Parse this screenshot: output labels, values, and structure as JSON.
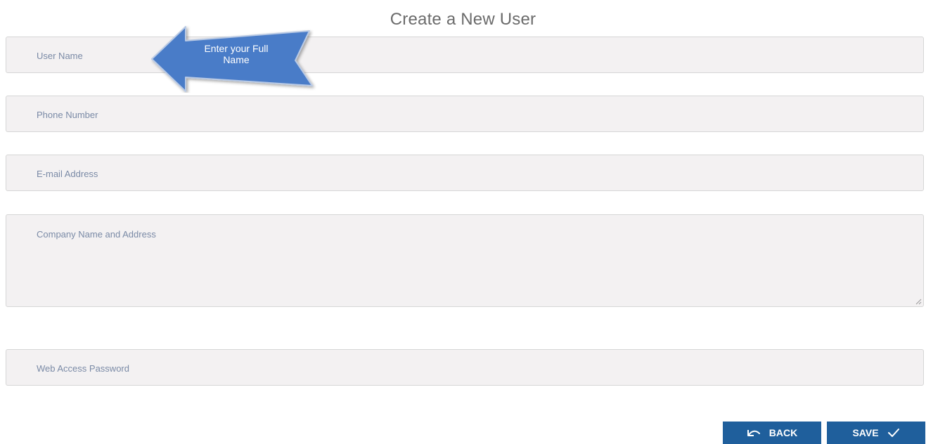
{
  "page": {
    "title": "Create a New User"
  },
  "form": {
    "user_name_placeholder": "User Name",
    "phone_placeholder": "Phone Number",
    "email_placeholder": "E-mail Address",
    "company_placeholder": "Company Name and Address",
    "password_placeholder": "Web Access Password"
  },
  "callout": {
    "text": "Enter your Full Name",
    "color": "#4a7bc8"
  },
  "buttons": {
    "back_label": "BACK",
    "back_icon": "undo-icon",
    "save_label": "SAVE",
    "save_icon": "check-icon",
    "color": "#1f5f9c"
  }
}
